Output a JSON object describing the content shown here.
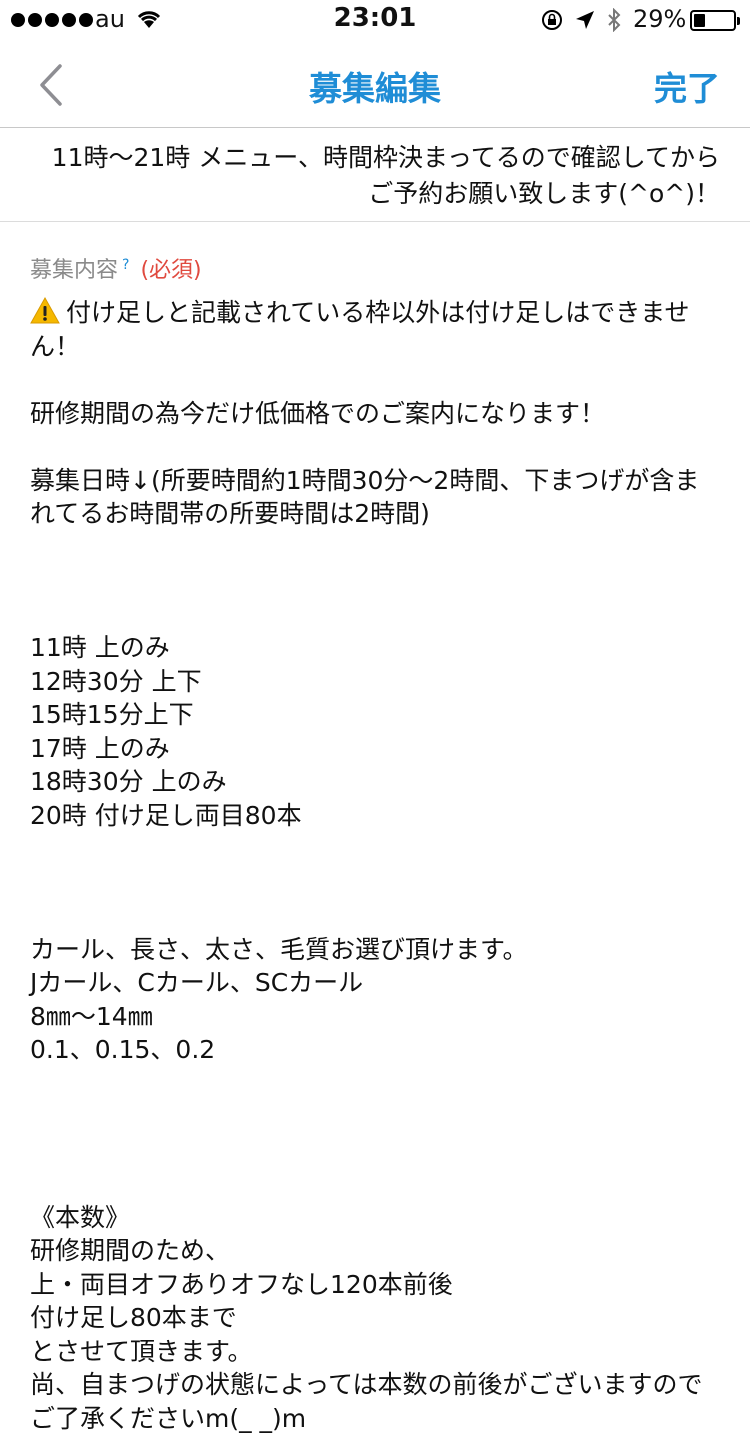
{
  "status": {
    "carrier": "au",
    "time": "23:01",
    "battery_percent_text": "29%",
    "battery_level": 0.29
  },
  "nav": {
    "title": "募集編集",
    "done_label": "完了"
  },
  "header_note": "11時〜21時 メニュー、時間枠決まってるので確認してからご予約お願い致します(^o^)！",
  "field": {
    "label": "募集内容",
    "help_marker": "?",
    "required": "(必須)"
  },
  "body_lines": [
    "付け足しと記載されている枠以外は付け足しはできません！",
    "",
    "研修期間の為今だけ低価格でのご案内になります！",
    "",
    "募集日時↓(所要時間約1時間30分〜2時間、下まつげが含まれてるお時間帯の所要時間は2時間)",
    "",
    "",
    "",
    "11時 上のみ",
    "12時30分 上下",
    "15時15分上下",
    "17時 上のみ",
    "18時30分 上のみ",
    "20時 付け足し両目80本",
    "",
    "",
    "",
    "カール、長さ、太さ、毛質お選び頂けます。",
    "Jカール、Cカール、SCカール",
    "8㎜〜14㎜",
    "0.1、0.15、0.2",
    "",
    "",
    "",
    "",
    "《本数》",
    "研修期間のため、",
    "上・両目オフありオフなし120本前後",
    "付け足し80本まで",
    "とさせて頂きます。",
    "尚、自まつげの状態によっては本数の前後がございますのでご了承くださいm(_ _)m"
  ],
  "colors": {
    "accent": "#1f8dd6",
    "required": "#e04a3f",
    "label": "#8a8a8a"
  }
}
